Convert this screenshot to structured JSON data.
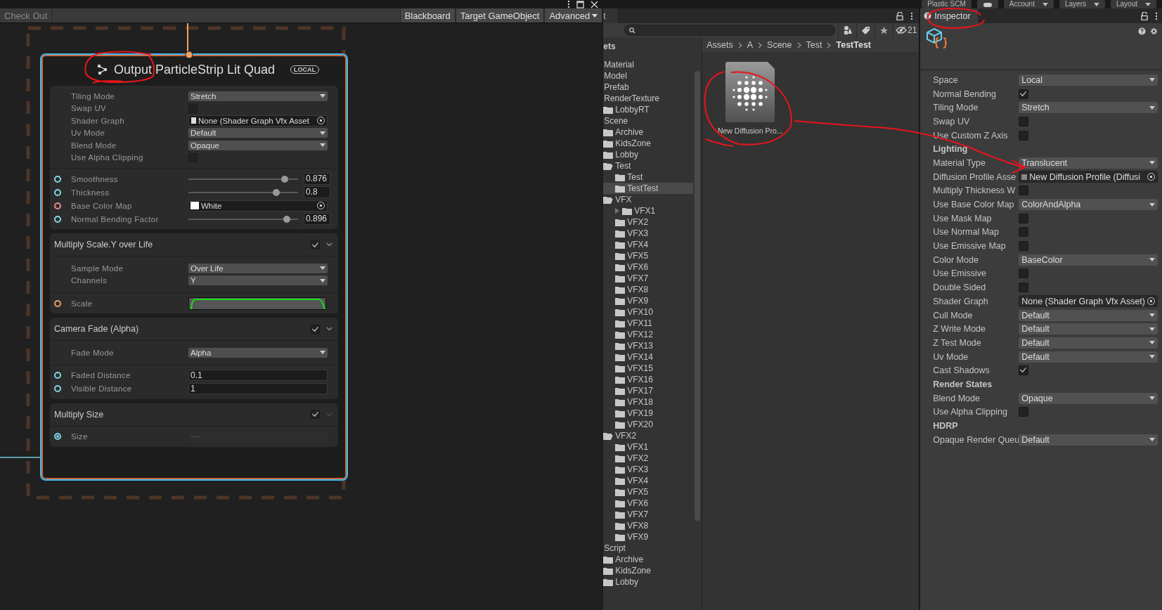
{
  "graph": {
    "toolbar": {
      "left": {
        "label": "Check Out",
        "disabled": true
      },
      "buttons": [
        "Blackboard",
        "Target GameObject"
      ],
      "dropdown": "Advanced"
    }
  },
  "node": {
    "title": "Output ParticleStrip Lit Quad",
    "badge": "LOCAL",
    "settings": [
      {
        "label": "Tiling Mode",
        "kind": "dropdown",
        "value": "Stretch"
      },
      {
        "label": "Swap UV",
        "kind": "checkbox",
        "checked": false
      },
      {
        "label": "Shader Graph",
        "kind": "object",
        "value": "None (Shader Graph Vfx Asset"
      },
      {
        "label": "Uv Mode",
        "kind": "dropdown",
        "value": "Default"
      },
      {
        "label": "Blend Mode",
        "kind": "dropdown",
        "value": "Opaque"
      },
      {
        "label": "Use Alpha Clipping",
        "kind": "checkbox",
        "checked": false
      }
    ],
    "ports": [
      {
        "label": "Smoothness",
        "kind": "slider",
        "value": "0.876",
        "color": "#7fd8e6",
        "connected": false
      },
      {
        "label": "Thickness",
        "kind": "slider",
        "value": "0.8",
        "color": "#7fd8e6",
        "connected": false
      },
      {
        "label": "Base Color Map",
        "kind": "texture",
        "value": "White",
        "color": "#e68a8a",
        "connected": false
      },
      {
        "label": "Normal Bending Factor",
        "kind": "slider",
        "value": "0.896",
        "color": "#7fd8e6",
        "connected": false
      }
    ],
    "blocks": [
      {
        "title": "Multiply Scale.Y over Life",
        "enabled": true,
        "settings": [
          {
            "label": "Sample Mode",
            "kind": "dropdown",
            "value": "Over Life"
          },
          {
            "label": "Channels",
            "kind": "dropdown",
            "value": "Y"
          }
        ],
        "ports": [
          {
            "label": "Scale",
            "kind": "curve",
            "color": "#f0a060",
            "connected": false
          }
        ]
      },
      {
        "title": "Camera Fade (Alpha)",
        "enabled": true,
        "settings": [
          {
            "label": "Fade Mode",
            "kind": "dropdown",
            "value": "Alpha"
          }
        ],
        "ports": [
          {
            "label": "Faded Distance",
            "kind": "field",
            "value": "0.1",
            "color": "#7fd8e6",
            "connected": false
          },
          {
            "label": "Visible Distance",
            "kind": "field",
            "value": "1",
            "color": "#7fd8e6",
            "connected": false
          }
        ]
      },
      {
        "title": "Multiply Size",
        "enabled": true,
        "ports": [
          {
            "label": "Size",
            "kind": "field",
            "placeholder": "—",
            "color": "#7fd8e6",
            "connected": true
          }
        ]
      }
    ]
  },
  "editor_toolbar": [
    {
      "kind": "button",
      "label": "Plastic SCM"
    },
    {
      "kind": "icon"
    },
    {
      "kind": "dropdown",
      "label": "Account"
    },
    {
      "kind": "dropdown",
      "label": "Layers"
    },
    {
      "kind": "dropdown",
      "label": "Layout"
    }
  ],
  "project": {
    "tab": "t",
    "hidden_count": "21",
    "root": "ets",
    "tree": [
      {
        "label": "Material",
        "selected": false
      },
      {
        "label": "Model",
        "selected": false
      },
      {
        "label": "Prefab",
        "selected": false
      },
      {
        "label": "RenderTexture",
        "selected": false,
        "children": [
          {
            "label": "LobbyRT",
            "selected": false
          }
        ]
      },
      {
        "label": "Scene",
        "selected": false,
        "children": [
          {
            "label": "Archive",
            "selected": false
          },
          {
            "label": "KidsZone",
            "selected": false
          },
          {
            "label": "Lobby",
            "selected": false
          },
          {
            "label": "Test",
            "selected": false,
            "expanded": true,
            "children": [
              {
                "label": "Test",
                "selected": false
              },
              {
                "label": "TestTest",
                "selected": true
              }
            ]
          },
          {
            "label": "VFX",
            "selected": false,
            "expanded": true,
            "children": [
              {
                "label": "VFX1",
                "selected": false,
                "expanded": false
              },
              {
                "label": "VFX2",
                "selected": false
              },
              {
                "label": "VFX3",
                "selected": false
              },
              {
                "label": "VFX4",
                "selected": false
              },
              {
                "label": "VFX5",
                "selected": false
              },
              {
                "label": "VFX6",
                "selected": false
              },
              {
                "label": "VFX7",
                "selected": false
              },
              {
                "label": "VFX8",
                "selected": false
              },
              {
                "label": "VFX9",
                "selected": false
              },
              {
                "label": "VFX10",
                "selected": false
              },
              {
                "label": "VFX11",
                "selected": false
              },
              {
                "label": "VFX12",
                "selected": false
              },
              {
                "label": "VFX13",
                "selected": false
              },
              {
                "label": "VFX14",
                "selected": false
              },
              {
                "label": "VFX15",
                "selected": false
              },
              {
                "label": "VFX16",
                "selected": false
              },
              {
                "label": "VFX17",
                "selected": false
              },
              {
                "label": "VFX18",
                "selected": false
              },
              {
                "label": "VFX19",
                "selected": false
              },
              {
                "label": "VFX20",
                "selected": false
              }
            ]
          },
          {
            "label": "VFX2",
            "selected": false,
            "expanded": true,
            "children": [
              {
                "label": "VFX1",
                "selected": false
              },
              {
                "label": "VFX2",
                "selected": false
              },
              {
                "label": "VFX3",
                "selected": false
              },
              {
                "label": "VFX4",
                "selected": false
              },
              {
                "label": "VFX5",
                "selected": false
              },
              {
                "label": "VFX6",
                "selected": false
              },
              {
                "label": "VFX7",
                "selected": false
              },
              {
                "label": "VFX8",
                "selected": false
              },
              {
                "label": "VFX9",
                "selected": false
              }
            ]
          }
        ]
      },
      {
        "label": "Script",
        "selected": false,
        "children": [
          {
            "label": "Archive",
            "selected": false
          },
          {
            "label": "KidsZone",
            "selected": false
          },
          {
            "label": "Lobby",
            "selected": false
          }
        ]
      }
    ],
    "breadcrumb": [
      "Assets",
      "A",
      "Scene",
      "Test",
      "TestTest"
    ],
    "assets": [
      {
        "name": "New Diffusion Pro..."
      }
    ]
  },
  "inspector": {
    "tab": "Inspector",
    "rows": [
      {
        "kind": "dropdown",
        "label": "Space",
        "value": "Local"
      },
      {
        "kind": "checkbox",
        "label": "Normal Bending",
        "checked": true
      },
      {
        "kind": "dropdown",
        "label": "Tiling Mode",
        "value": "Stretch"
      },
      {
        "kind": "checkbox",
        "label": "Swap UV",
        "checked": false
      },
      {
        "kind": "checkbox",
        "label": "Use Custom Z Axis",
        "checked": false
      },
      {
        "kind": "header",
        "label": "Lighting"
      },
      {
        "kind": "dropdown",
        "label": "Material Type",
        "value": "Translucent"
      },
      {
        "kind": "object",
        "label": "Diffusion Profile Asse",
        "value": "New Diffusion Profile (Diffusi",
        "icon": true
      },
      {
        "kind": "checkbox",
        "label": "Multiply Thickness W",
        "checked": false
      },
      {
        "kind": "dropdown",
        "label": "Use Base Color Map",
        "value": "ColorAndAlpha"
      },
      {
        "kind": "checkbox",
        "label": "Use Mask Map",
        "checked": false
      },
      {
        "kind": "checkbox",
        "label": "Use Normal Map",
        "checked": false
      },
      {
        "kind": "checkbox",
        "label": "Use Emissive Map",
        "checked": false
      },
      {
        "kind": "dropdown",
        "label": "Color Mode",
        "value": "BaseColor"
      },
      {
        "kind": "checkbox",
        "label": "Use Emissive",
        "checked": false
      },
      {
        "kind": "checkbox",
        "label": "Double Sided",
        "checked": false
      },
      {
        "kind": "object",
        "label": "Shader Graph",
        "value": "None (Shader Graph Vfx Asset)",
        "icon": false
      },
      {
        "kind": "dropdown",
        "label": "Cull Mode",
        "value": "Default"
      },
      {
        "kind": "dropdown",
        "label": "Z Write Mode",
        "value": "Default"
      },
      {
        "kind": "dropdown",
        "label": "Z Test Mode",
        "value": "Default"
      },
      {
        "kind": "dropdown",
        "label": "Uv Mode",
        "value": "Default"
      },
      {
        "kind": "checkbox",
        "label": "Cast Shadows",
        "checked": true
      },
      {
        "kind": "header",
        "label": "Render States"
      },
      {
        "kind": "dropdown",
        "label": "Blend Mode",
        "value": "Opaque"
      },
      {
        "kind": "checkbox",
        "label": "Use Alpha Clipping",
        "checked": false
      },
      {
        "kind": "header",
        "label": "HDRP"
      },
      {
        "kind": "dropdown",
        "label": "Opaque Render Queu",
        "value": "Default"
      }
    ]
  }
}
